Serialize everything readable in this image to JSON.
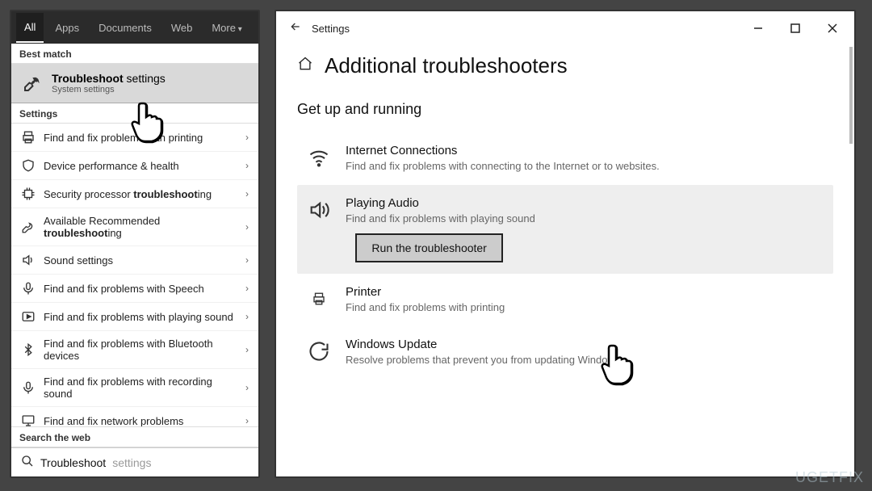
{
  "search": {
    "tabs": [
      "All",
      "Apps",
      "Documents",
      "Web",
      "More"
    ],
    "active_tab": 0,
    "best_match_label": "Best match",
    "best_match": {
      "title_prefix": "Troubleshoot",
      "title_suffix": " settings",
      "subtitle": "System settings"
    },
    "settings_label": "Settings",
    "items": [
      {
        "icon": "printer",
        "text_html": "Find and fix problems with printing"
      },
      {
        "icon": "shield",
        "text_html": "Device performance & health"
      },
      {
        "icon": "chip",
        "text_html": "Security processor <b>troubleshoot</b>ing"
      },
      {
        "icon": "wrench",
        "text_html": "Available Recommended <b>troubleshoot</b>ing"
      },
      {
        "icon": "sound",
        "text_html": "Sound settings"
      },
      {
        "icon": "mic",
        "text_html": "Find and fix problems with Speech"
      },
      {
        "icon": "play",
        "text_html": "Find and fix problems with playing sound"
      },
      {
        "icon": "bluetooth",
        "text_html": "Find and fix problems with Bluetooth devices"
      },
      {
        "icon": "mic",
        "text_html": "Find and fix problems with recording sound"
      },
      {
        "icon": "network",
        "text_html": "Find and fix network problems"
      }
    ],
    "search_web_label": "Search the web",
    "query_typed": "Troubleshoot",
    "query_hint": " settings"
  },
  "settings_window": {
    "app_title": "Settings",
    "page_title": "Additional troubleshooters",
    "subheading": "Get up and running",
    "run_button": "Run the troubleshooter",
    "items": [
      {
        "icon": "wifi",
        "title": "Internet Connections",
        "desc": "Find and fix problems with connecting to the Internet or to websites.",
        "selected": false
      },
      {
        "icon": "speaker",
        "title": "Playing Audio",
        "desc": "Find and fix problems with playing sound",
        "selected": true
      },
      {
        "icon": "printer",
        "title": "Printer",
        "desc": "Find and fix problems with printing",
        "selected": false
      },
      {
        "icon": "update",
        "title": "Windows Update",
        "desc": "Resolve problems that prevent you from updating Windows.",
        "selected": false
      }
    ]
  },
  "watermark": "UGETFIX"
}
